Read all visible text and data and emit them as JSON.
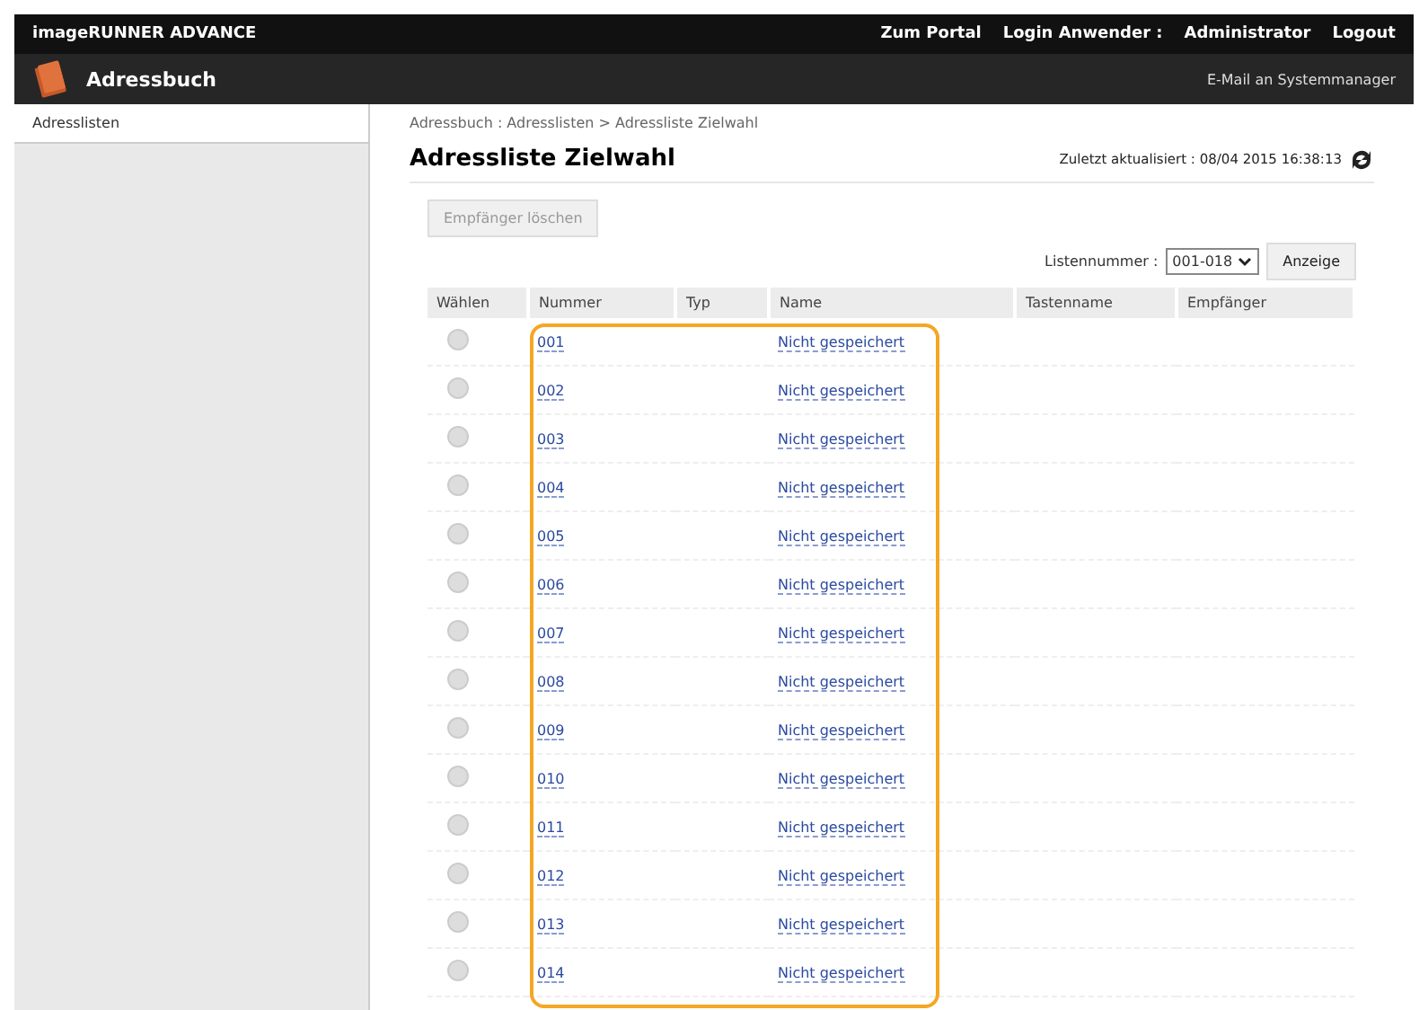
{
  "header": {
    "product": "imageRUNNER ADVANCE",
    "links": [
      "Zum Portal",
      "Login Anwender :",
      "Administrator",
      "Logout"
    ]
  },
  "app_bar": {
    "title": "Adressbuch",
    "link": "E-Mail an Systemmanager"
  },
  "sidebar": {
    "items": [
      {
        "label": "Adresslisten",
        "selected": true
      }
    ]
  },
  "breadcrumb": "Adressbuch : Adresslisten > Adressliste Zielwahl",
  "page_title": "Adressliste Zielwahl",
  "updated": "Zuletzt aktualisiert : 08/04 2015 16:38:13",
  "delete_button": {
    "label": "Empfänger löschen",
    "disabled": true
  },
  "list_number": {
    "label": "Listennummer :",
    "value": "001-018",
    "button": "Anzeige"
  },
  "table": {
    "columns": [
      "Wählen",
      "Nummer",
      "Typ",
      "Name",
      "Tastenname",
      "Empfänger"
    ],
    "rows": [
      {
        "number": "001",
        "name": "Nicht gespeichert",
        "checked": false
      },
      {
        "number": "002",
        "name": "Nicht gespeichert",
        "checked": false
      },
      {
        "number": "003",
        "name": "Nicht gespeichert",
        "checked": false
      },
      {
        "number": "004",
        "name": "Nicht gespeichert",
        "checked": false
      },
      {
        "number": "005",
        "name": "Nicht gespeichert",
        "checked": false
      },
      {
        "number": "006",
        "name": "Nicht gespeichert",
        "checked": false
      },
      {
        "number": "007",
        "name": "Nicht gespeichert",
        "checked": false
      },
      {
        "number": "008",
        "name": "Nicht gespeichert",
        "checked": false
      },
      {
        "number": "009",
        "name": "Nicht gespeichert",
        "checked": false
      },
      {
        "number": "010",
        "name": "Nicht gespeichert",
        "checked": false
      },
      {
        "number": "011",
        "name": "Nicht gespeichert",
        "checked": false
      },
      {
        "number": "012",
        "name": "Nicht gespeichert",
        "checked": false
      },
      {
        "number": "013",
        "name": "Nicht gespeichert",
        "checked": false
      },
      {
        "number": "014",
        "name": "Nicht gespeichert",
        "checked": false
      }
    ]
  }
}
